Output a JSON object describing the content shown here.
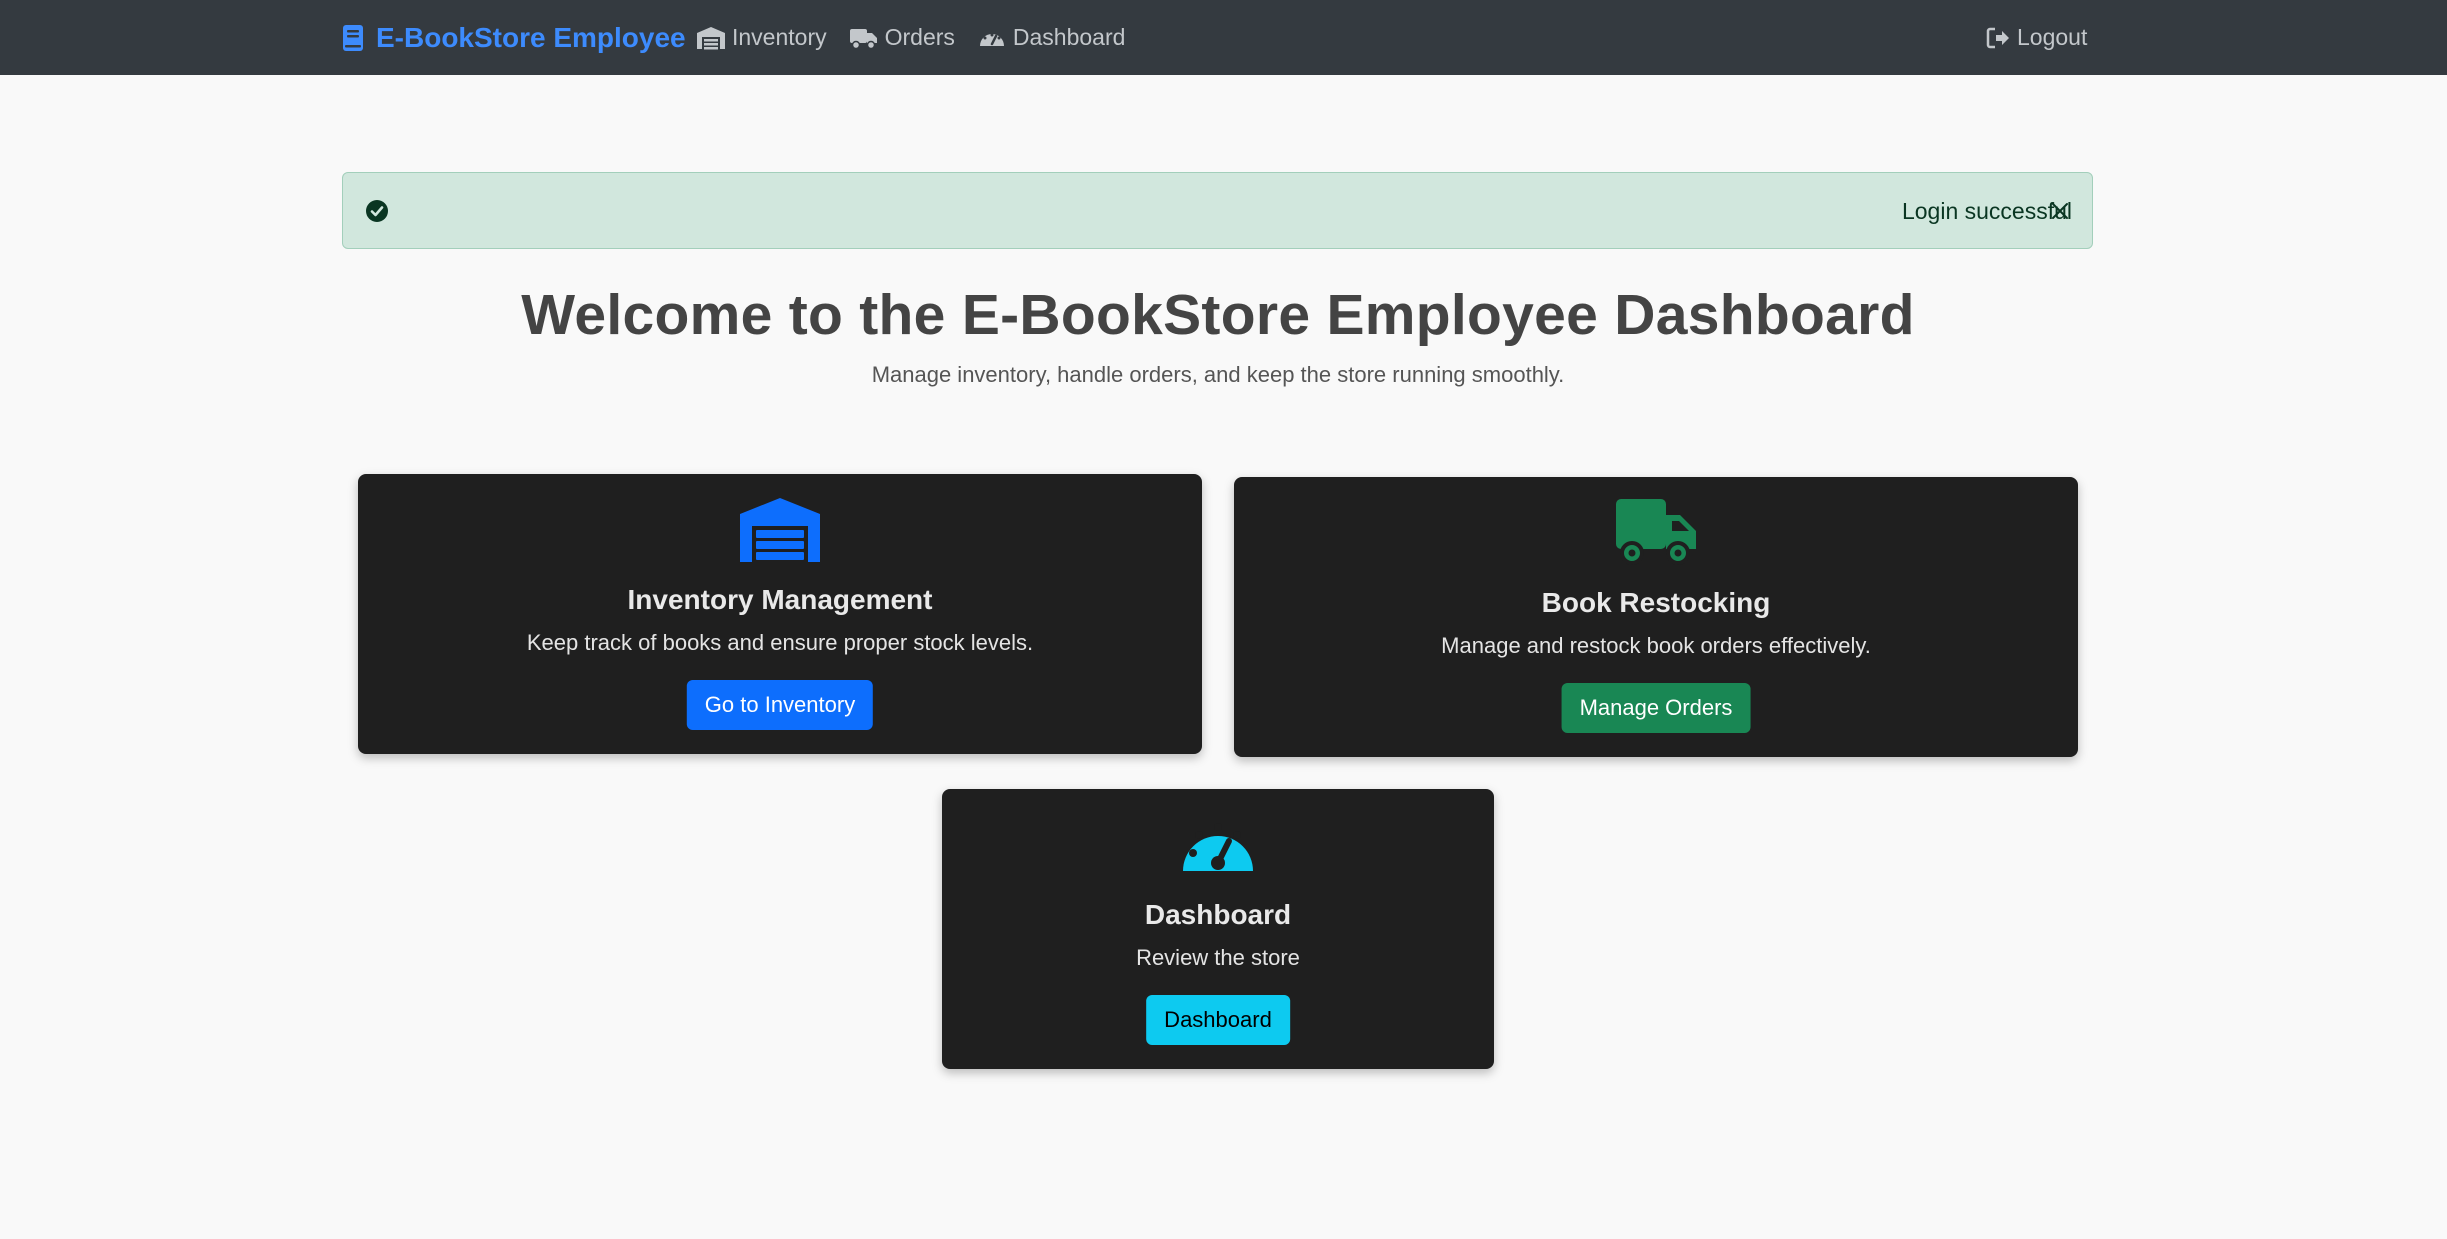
{
  "navbar": {
    "brand": "E-BookStore Employee",
    "links": [
      {
        "label": "Inventory",
        "icon": "warehouse-icon"
      },
      {
        "label": "Orders",
        "icon": "truck-icon"
      },
      {
        "label": "Dashboard",
        "icon": "gauge-icon"
      }
    ],
    "logout": "Logout",
    "colors": {
      "background": "#343a40",
      "brand": "#3d8bfd",
      "link": "#c3c7cb"
    }
  },
  "alert": {
    "message": "Login successful",
    "icon": "check-circle-icon",
    "close_icon": "close-icon",
    "colors": {
      "background": "#d1e7dd",
      "text": "#0a3622"
    }
  },
  "header": {
    "title": "Welcome to the E-BookStore Employee Dashboard",
    "subtitle": "Manage inventory, handle orders, and keep the store running smoothly."
  },
  "cards": [
    {
      "title": "Inventory Management",
      "text": "Keep track of books and ensure proper stock levels.",
      "button": "Go to Inventory",
      "icon": "warehouse-icon",
      "accent": "#0d6efd"
    },
    {
      "title": "Book Restocking",
      "text": "Manage and restock book orders effectively.",
      "button": "Manage Orders",
      "icon": "truck-icon",
      "accent": "#198754"
    },
    {
      "title": "Dashboard",
      "text": "Review the store",
      "button": "Dashboard",
      "icon": "gauge-icon",
      "accent": "#0dcaf0"
    }
  ]
}
